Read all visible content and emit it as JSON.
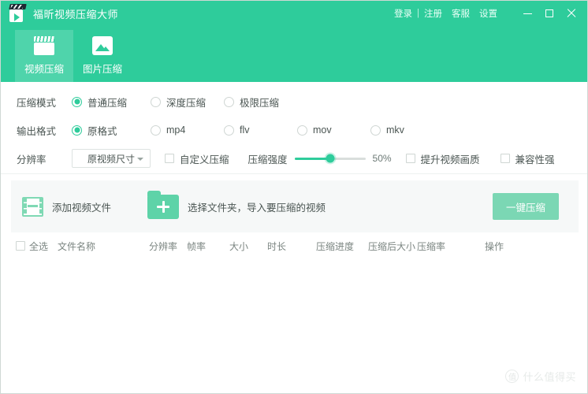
{
  "titlebar": {
    "app_title": "福昕视频压缩大师",
    "logo_icon": "clapperboard-play-logo",
    "login": "登录",
    "separator": "|",
    "register": "注册",
    "support": "客服",
    "settings": "设置",
    "minimize_icon": "minimize-icon",
    "maximize_icon": "maximize-icon",
    "close_icon": "close-icon",
    "bg_color": "#2ecc9b"
  },
  "tabs": [
    {
      "label": "视频压缩",
      "icon": "clapperboard-icon",
      "active": true
    },
    {
      "label": "图片压缩",
      "icon": "picture-icon",
      "active": false
    }
  ],
  "settings_panel": {
    "compress_mode": {
      "label": "压缩模式",
      "options": [
        {
          "label": "普通压缩",
          "selected": true
        },
        {
          "label": "深度压缩",
          "selected": false
        },
        {
          "label": "极限压缩",
          "selected": false
        }
      ]
    },
    "output_format": {
      "label": "输出格式",
      "options": [
        {
          "label": "原格式",
          "selected": true
        },
        {
          "label": "mp4",
          "selected": false
        },
        {
          "label": "flv",
          "selected": false
        },
        {
          "label": "mov",
          "selected": false
        },
        {
          "label": "mkv",
          "selected": false
        }
      ]
    },
    "resolution": {
      "label": "分辨率",
      "select_value": "原视频尺寸",
      "custom_compress": {
        "label": "自定义压缩",
        "checked": false
      },
      "strength": {
        "label": "压缩强度",
        "value": 50,
        "value_text": "50%"
      },
      "enhance_quality": {
        "label": "提升视频画质",
        "checked": false
      },
      "compatibility": {
        "label": "兼容性强",
        "checked": false
      }
    }
  },
  "drop_area": {
    "add_video_label": "添加视频文件",
    "add_video_icon": "film-icon",
    "choose_folder_label": "选择文件夹，导入要压缩的视频",
    "choose_folder_icon": "folder-plus-icon",
    "compress_button": "一键压缩",
    "compress_button_color": "#7bd7b4"
  },
  "file_table": {
    "select_all_label": "全选",
    "columns": [
      "文件名称",
      "分辨率",
      "帧率",
      "大小",
      "时长",
      "压缩进度",
      "压缩后大小",
      "压缩率",
      "操作"
    ],
    "rows": []
  },
  "watermark": {
    "logo_char": "值",
    "text": "什么值得买"
  }
}
